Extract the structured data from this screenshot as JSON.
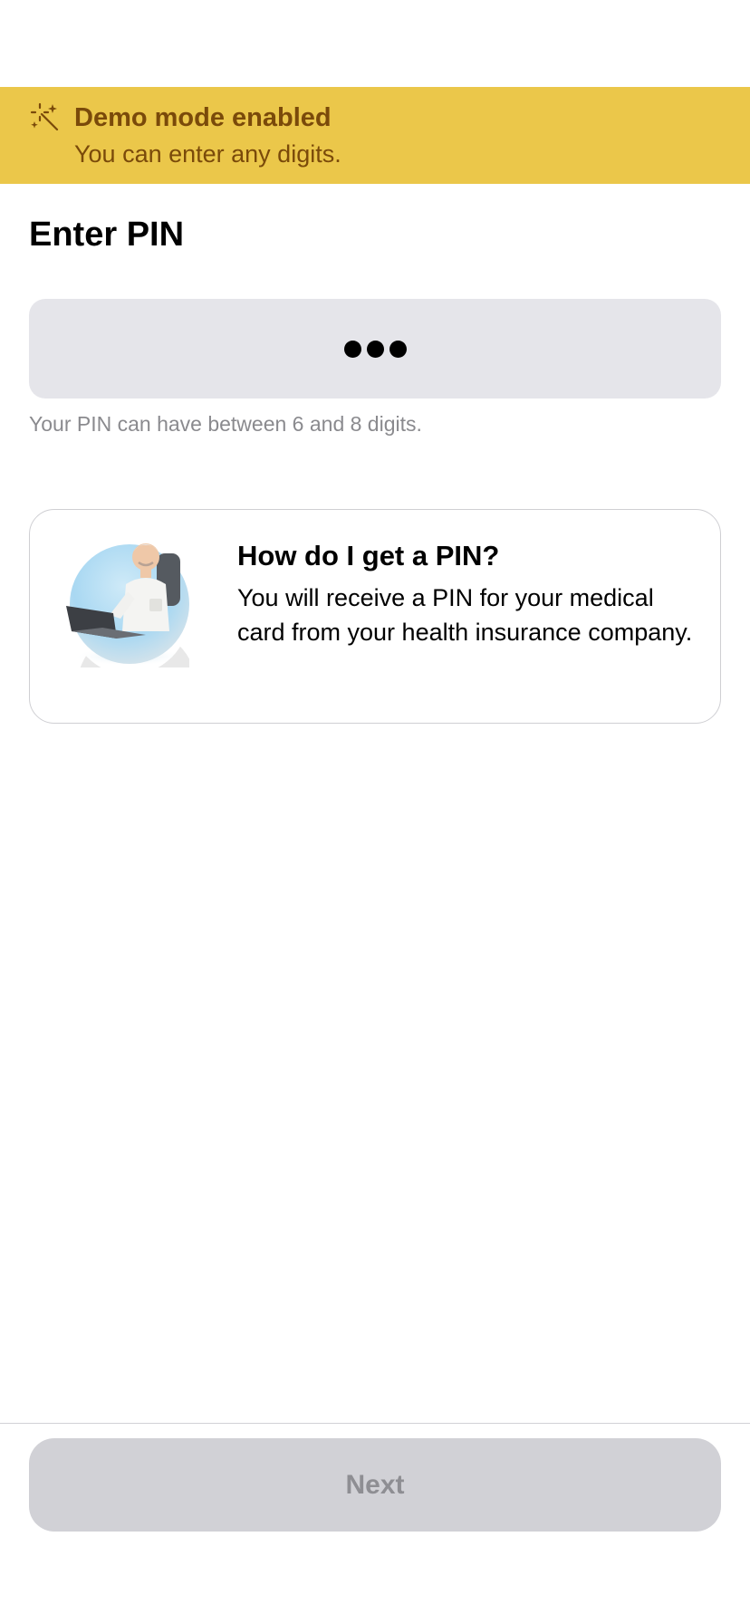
{
  "colors": {
    "banner_background": "#ebc74a",
    "banner_text": "#7a4a0a",
    "pin_field_background": "#e5e5ea",
    "hint_text": "#8a8a8e",
    "button_background": "#d1d1d6",
    "button_text": "#8e8e93"
  },
  "banner": {
    "icon": "magic-wand-sparkles-icon",
    "title": "Demo mode enabled",
    "subtitle": "You can enter any digits."
  },
  "page": {
    "title": "Enter PIN"
  },
  "pin": {
    "entered_digits": 3,
    "hint": "Your PIN can have between 6 and 8 digits."
  },
  "info_card": {
    "image": "doctor-at-laptop-illustration",
    "title": "How do I get a PIN?",
    "body": "You will receive a PIN for your medical card from your health insurance company."
  },
  "footer": {
    "next_label": "Next",
    "next_enabled": false
  }
}
